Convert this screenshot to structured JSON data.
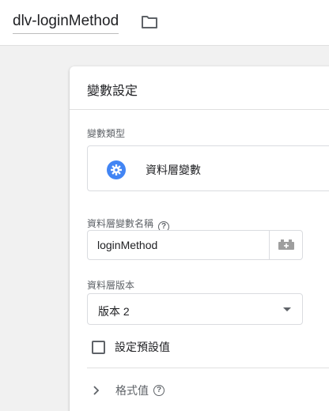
{
  "header": {
    "variable_name": "dlv-loginMethod",
    "folder_icon": "folder-icon"
  },
  "panel": {
    "title": "變數設定",
    "variable_type": {
      "label": "變數類型",
      "selected_type": "資料層變數",
      "icon": "gear-icon",
      "icon_color": "#4285f4"
    },
    "dlv_name": {
      "label": "資料層變數名稱",
      "value": "loginMethod",
      "help_icon": "help-icon",
      "help_glyph": "?",
      "picker_icon": "variable-picker-icon"
    },
    "dl_version": {
      "label": "資料層版本",
      "selected": "版本 2"
    },
    "default_value": {
      "label": "設定預設值",
      "checked": false
    },
    "format_value": {
      "label": "格式值",
      "expanded": false,
      "help_glyph": "?"
    }
  }
}
